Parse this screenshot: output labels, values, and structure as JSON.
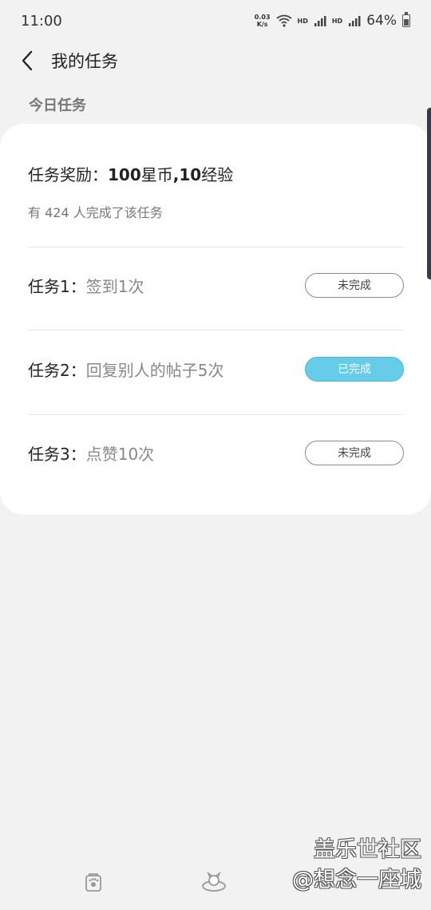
{
  "status_bar": {
    "time": "11:00",
    "net_speed_value": "0.03",
    "net_speed_unit": "K/s",
    "hd1": "HD",
    "hd2": "HD",
    "battery": "64%"
  },
  "header": {
    "title": "我的任务"
  },
  "section": {
    "title": "今日任务"
  },
  "reward": {
    "prefix": "任务奖励：",
    "coins": "100",
    "coins_unit": "星币",
    "sep": ",",
    "exp": "10",
    "exp_unit": "经验"
  },
  "completed_count": "有 424 人完成了该任务",
  "tasks": [
    {
      "num": "任务1：",
      "desc": "签到1次",
      "status": "未完成",
      "done": false
    },
    {
      "num": "任务2：",
      "desc": "回复别人的帖子5次",
      "status": "已完成",
      "done": true
    },
    {
      "num": "任务3：",
      "desc": "点赞10次",
      "status": "未完成",
      "done": false
    }
  ],
  "watermark": {
    "line1": "盖乐世社区",
    "line2": "@想念一座城"
  },
  "colors": {
    "background": "#f2f2f2",
    "done_pill": "#66cce9"
  }
}
